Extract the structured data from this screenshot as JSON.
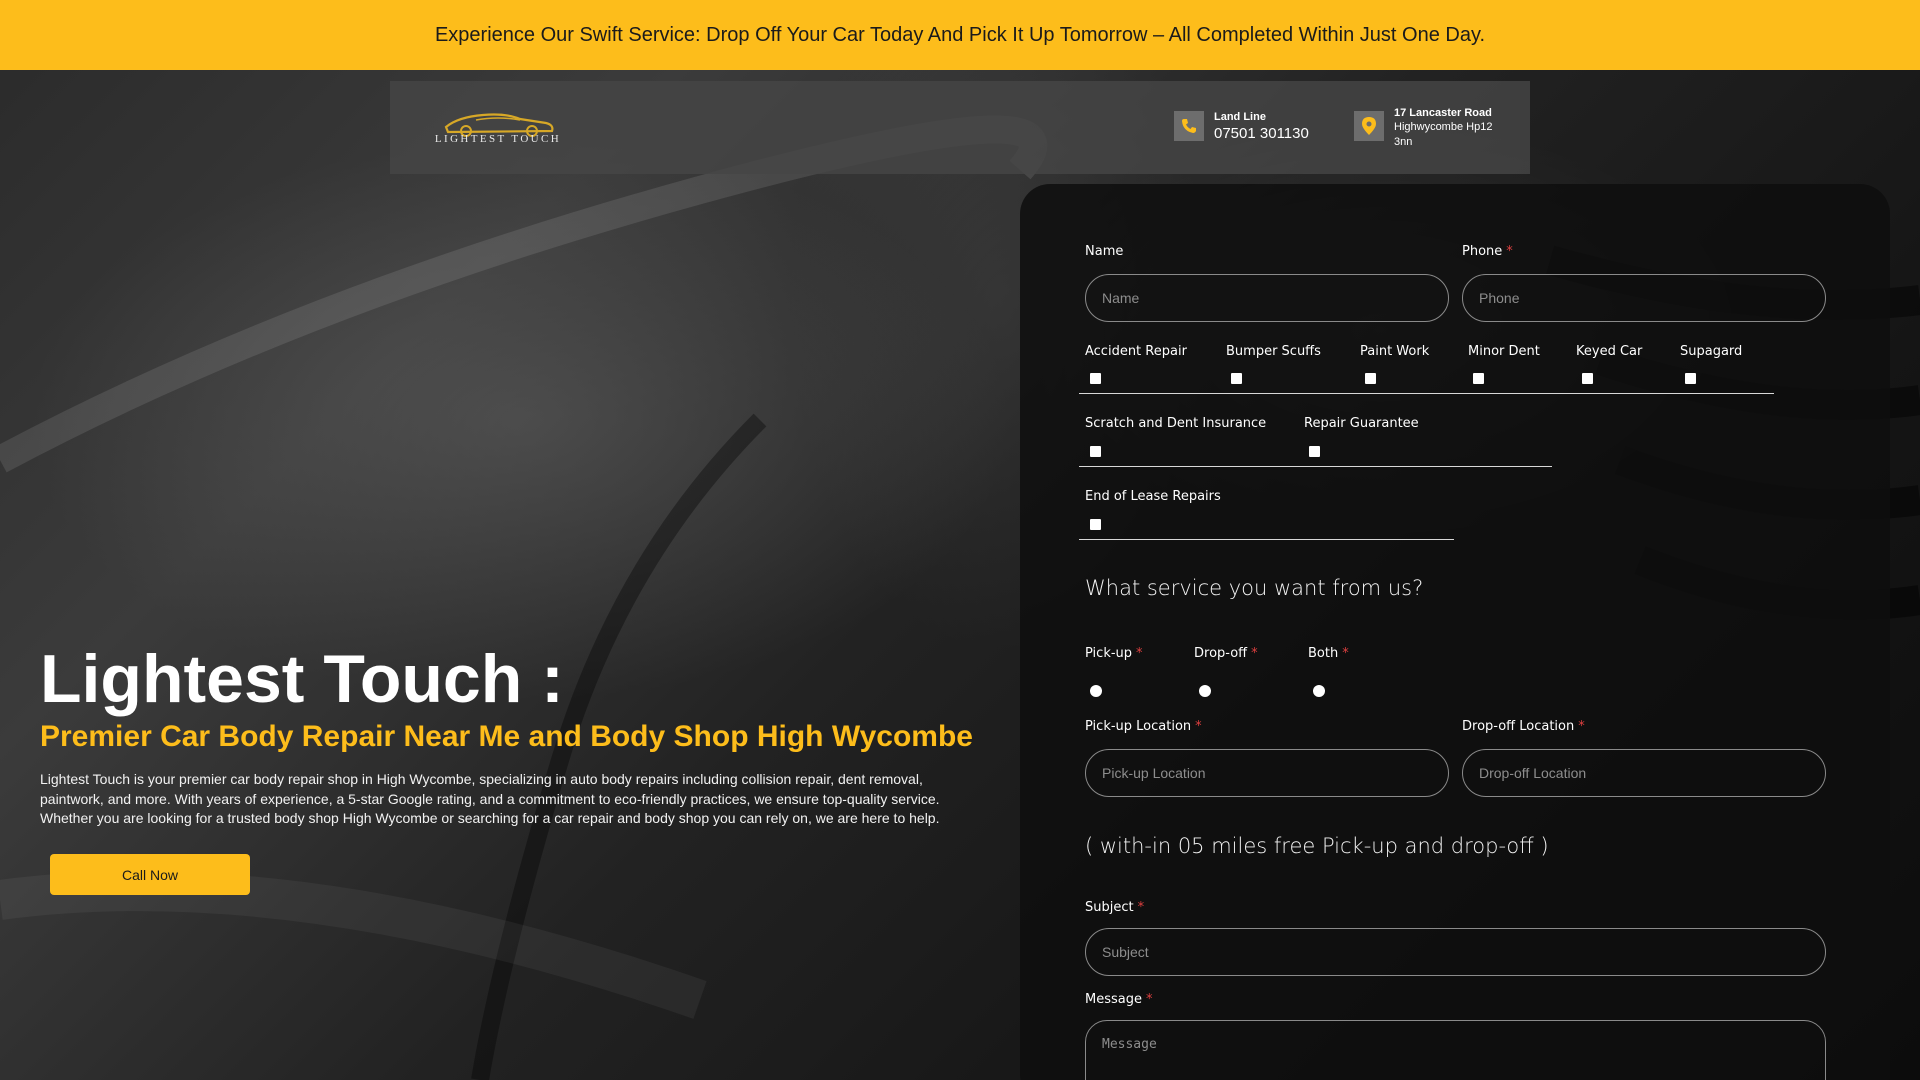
{
  "promo": {
    "text": "Experience Our Swift Service: Drop Off Your Car Today And Pick It Up Tomorrow – All Completed Within Just One Day."
  },
  "header": {
    "logo_text": "LIGHTEST TOUCH",
    "landline_title": "Land Line",
    "landline_number": "07501 301130",
    "address_line1": "17 Lancaster Road",
    "address_line2": "Highwycombe Hp12",
    "address_line3": "3nn"
  },
  "hero": {
    "title": "Lightest Touch :",
    "subtitle": "Premier Car Body Repair Near Me and Body Shop High Wycombe",
    "description": "Lightest Touch is your premier car body repair shop in High Wycombe, specializing in auto body repairs including collision repair, dent removal, paintwork, and more. With years of experience, a 5-star Google rating, and a commitment to eco-friendly practices, we ensure top-quality service. Whether you are looking for a trusted body shop High Wycombe or searching for a car repair and body shop you can rely on, we are here to help.",
    "cta_label": "Call Now"
  },
  "form": {
    "name_label": "Name",
    "name_placeholder": "Name",
    "phone_label": "Phone",
    "phone_placeholder": "Phone",
    "services_row1": [
      "Accident Repair",
      "Bumper Scuffs",
      "Paint Work",
      "Minor Dent",
      "Keyed Car",
      "Supagard"
    ],
    "services_row2": [
      "Scratch and Dent Insurance",
      "Repair Guarantee"
    ],
    "services_row3": [
      "End of Lease Repairs"
    ],
    "service_question": "What service you want from us?",
    "options": [
      "Pick-up",
      "Drop-off",
      "Both"
    ],
    "pickup_location_label": "Pick-up Location",
    "pickup_location_placeholder": "Pick-up Location",
    "dropoff_location_label": "Drop-off Location",
    "dropoff_location_placeholder": "Drop-off Location",
    "free_note": "( with-in 05 miles free Pick-up and drop-off )",
    "subject_label": "Subject",
    "subject_placeholder": "Subject",
    "message_label": "Message",
    "message_placeholder": "Message",
    "required_mark": "*"
  },
  "colors": {
    "accent": "#fdbd1b",
    "required": "#e04040"
  },
  "icons": {
    "phone": "phone-icon",
    "location": "location-pin-icon",
    "logo": "car-logo-icon"
  }
}
